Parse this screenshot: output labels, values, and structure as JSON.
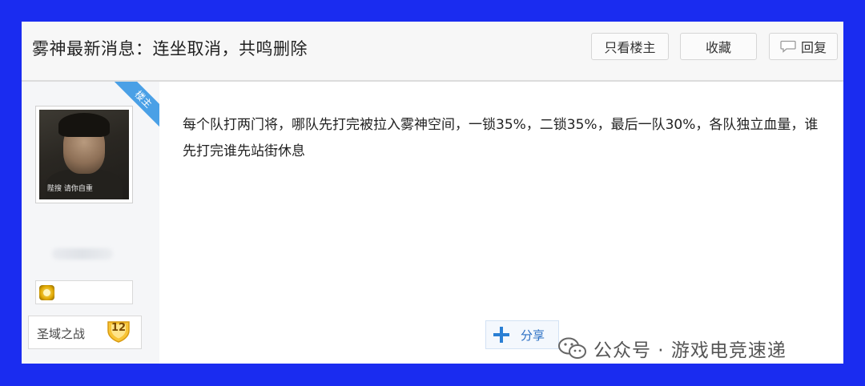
{
  "thread": {
    "title": "雾神最新消息：连坐取消，共鸣删除"
  },
  "header": {
    "owner_only_label": "只看楼主",
    "favorite_label": "收藏",
    "reply_label": "回复"
  },
  "author": {
    "badge": "楼主",
    "avatar_caption": "陛搜 请你自重",
    "rank_name": "圣域之战",
    "rank_level": "12"
  },
  "post": {
    "content": "每个队打两门将，哪队先打完被拉入雾神空间，一锁35%，二锁35%，最后一队30%，各队独立血量，谁先打完谁先站街休息",
    "share_label": "分享"
  },
  "watermark": {
    "text": "公众号 · 游戏电竞速递"
  },
  "colors": {
    "frame_blue": "#1a2cf0",
    "badge_blue": "#4aa0e6",
    "share_blue": "#2a7fd4"
  },
  "icons": {
    "reply": "speech-bubble-icon",
    "share": "plus-icon",
    "medal": "medal-icon",
    "watermark": "wechat-icon"
  }
}
